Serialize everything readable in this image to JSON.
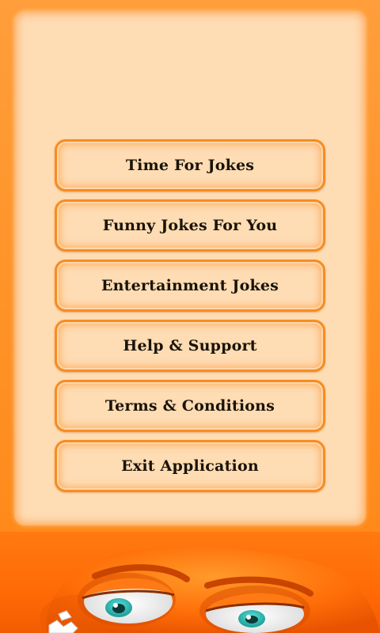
{
  "menu": {
    "items": [
      {
        "label": "Time For Jokes"
      },
      {
        "label": "Funny Jokes For You"
      },
      {
        "label": "Entertainment Jokes"
      },
      {
        "label": "Help & Support"
      },
      {
        "label": "Terms & Conditions"
      },
      {
        "label": "Exit Application"
      }
    ]
  },
  "mascot": {
    "icon": "angry-orange-face-icon"
  },
  "colors": {
    "background_orange": "#ff8a1a",
    "panel_cream": "#fedcb4",
    "button_border": "#f78c22",
    "text": "#1a1308"
  }
}
